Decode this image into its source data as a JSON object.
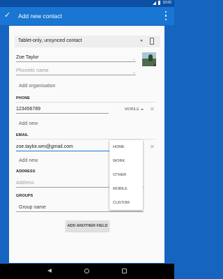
{
  "status_bar": {
    "time": "10:00"
  },
  "app_bar": {
    "check_glyph": "✓",
    "title": "Add new contact",
    "more_icon": "more-vert-icon"
  },
  "account": {
    "label": "Tablet-only, unsynced contact",
    "icon": "phone-icon"
  },
  "name": {
    "value": "Zoe Taylor",
    "phonetic_placeholder": "Phonetic name",
    "add_organisation": "Add organisation"
  },
  "phone": {
    "section_label": "PHONE",
    "value": "123456789",
    "type": "MOBILE",
    "add_new": "Add new"
  },
  "email": {
    "section_label": "EMAIL",
    "value": "zoe.taylor.wm@gmail.com",
    "add_new": "Add new"
  },
  "email_type_menu": {
    "options": [
      "HOME",
      "WORK",
      "OTHER",
      "MOBILE",
      "CUSTOM"
    ]
  },
  "address": {
    "section_label": "ADDRESS",
    "placeholder": "Address"
  },
  "groups": {
    "section_label": "GROUPS",
    "placeholder": "Group name"
  },
  "add_another_field": "ADD ANOTHER FIELD",
  "colors": {
    "app_bar": "#1976d2",
    "status_bar": "#0d4fa3",
    "background": "#1565c0",
    "accent": "#1976d2"
  }
}
